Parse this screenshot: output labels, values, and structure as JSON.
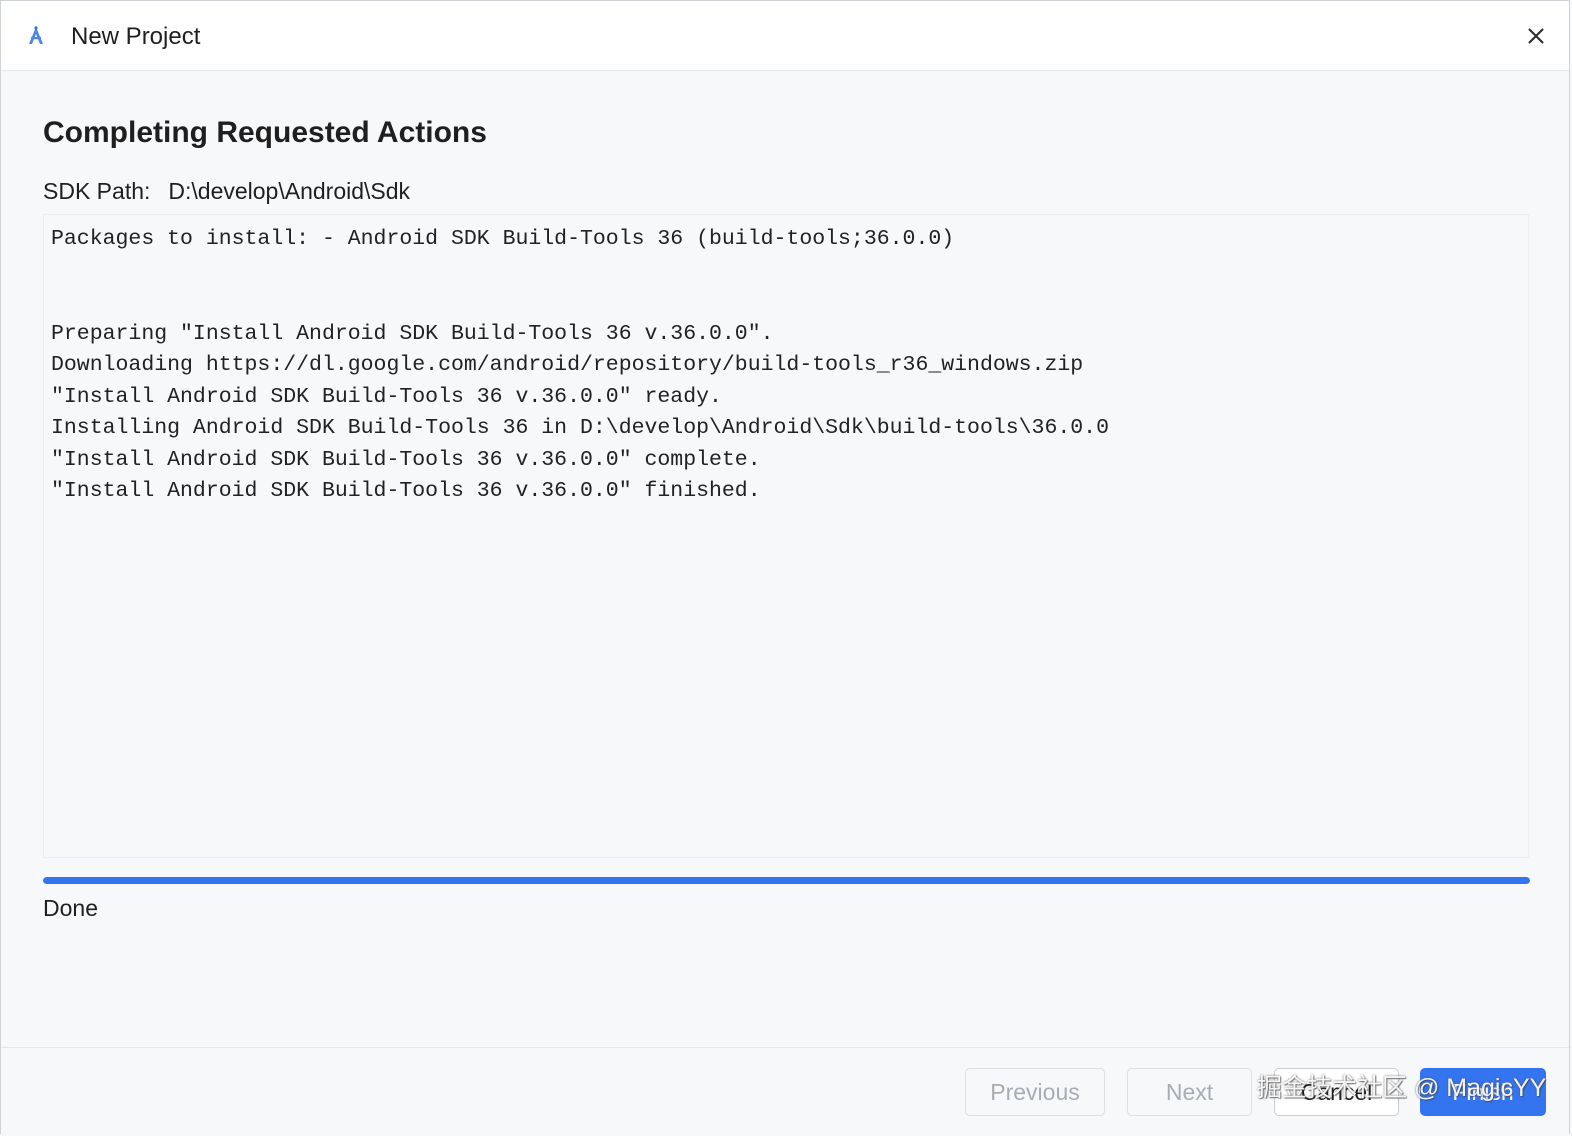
{
  "window": {
    "title": "New Project",
    "app_icon": "android-studio-icon",
    "close_icon": "close-icon"
  },
  "main": {
    "heading": "Completing Requested Actions",
    "sdk_path_label": "SDK Path:",
    "sdk_path_value": "D:\\develop\\Android\\Sdk",
    "log_lines": [
      "Packages to install: - Android SDK Build-Tools 36 (build-tools;36.0.0)",
      "",
      "",
      "Preparing \"Install Android SDK Build-Tools 36 v.36.0.0\".",
      "Downloading https://dl.google.com/android/repository/build-tools_r36_windows.zip",
      "\"Install Android SDK Build-Tools 36 v.36.0.0\" ready.",
      "Installing Android SDK Build-Tools 36 in D:\\develop\\Android\\Sdk\\build-tools\\36.0.0",
      "\"Install Android SDK Build-Tools 36 v.36.0.0\" complete.",
      "\"Install Android SDK Build-Tools 36 v.36.0.0\" finished."
    ],
    "progress_percent": 100,
    "status": "Done"
  },
  "footer": {
    "previous_label": "Previous",
    "next_label": "Next",
    "cancel_label": "Cancel",
    "finish_label": "Finish"
  },
  "watermark": "掘金技术社区 @ MagicYY",
  "colors": {
    "accent": "#3574f0",
    "background": "#f7f8fa",
    "title_bar": "#ffffff",
    "disabled_text": "#a8adb3"
  }
}
